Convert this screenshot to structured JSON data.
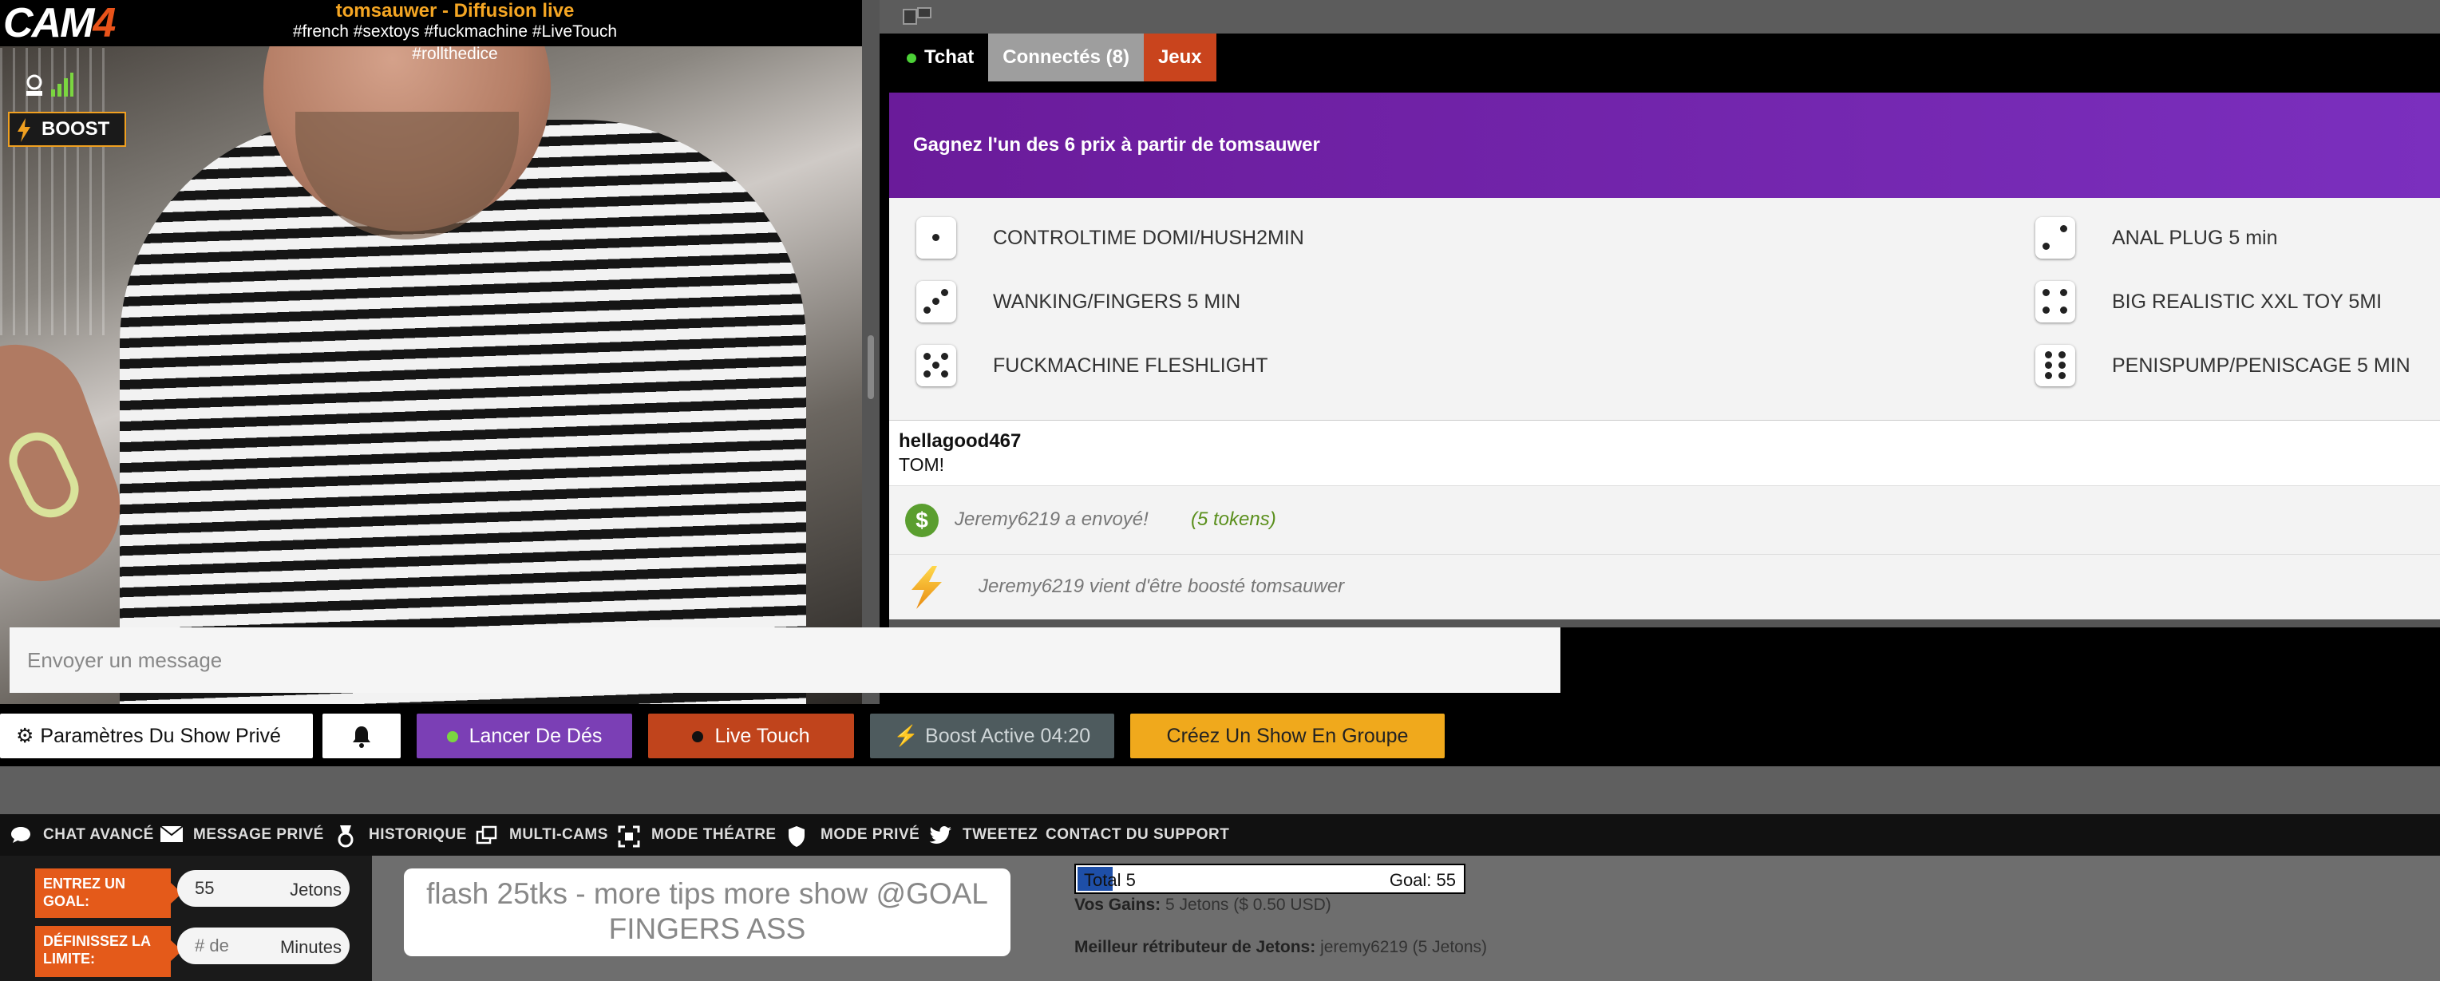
{
  "header": {
    "logo": "CAM4",
    "logo_main": "CAM",
    "logo_number": "4",
    "title": "tomsauwer - Diffusion live",
    "tags": "#french #sextoys #fuckmachine #LiveTouch #rollthedice",
    "boost_label": "BOOST"
  },
  "tabs": {
    "chat": "Tchat",
    "users": "Connectés (8)",
    "games": "Jeux"
  },
  "game": {
    "header": "Gagnez l'un des 6 prix à partir de tomsauwer",
    "prizes": [
      {
        "die": 1,
        "label": "CONTROLTIME DOMI/HUSH2MIN"
      },
      {
        "die": 2,
        "label": "ANAL PLUG 5 min"
      },
      {
        "die": 3,
        "label": "WANKING/FINGERS 5 MIN"
      },
      {
        "die": 4,
        "label": "BIG REALISTIC XXL TOY 5MI"
      },
      {
        "die": 5,
        "label": "FUCKMACHINE FLESHLIGHT"
      },
      {
        "die": 6,
        "label": "PENISPUMP/PENISCAGE 5 MIN"
      }
    ]
  },
  "chat": {
    "messages": [
      {
        "user": "hellagood467",
        "text": "TOM!"
      }
    ],
    "tip_notice": "Jeremy6219 a envoyé!",
    "tip_amount": "(5 tokens)",
    "boost_notice": "Jeremy6219 vient d'être boosté tomsauwer",
    "input_placeholder": "Envoyer un message"
  },
  "toolbar": {
    "private_show": "Paramètres Du Show Privé",
    "dice": "Lancer De Dés",
    "live_touch": "Live Touch",
    "boost_active": "Boost Active 04:20",
    "group_show": "Créez Un Show En Groupe"
  },
  "nav": {
    "advanced_chat": "CHAT AVANCÉ",
    "private_message": "MESSAGE PRIVÉ",
    "history": "HISTORIQUE",
    "multicam": "MULTI-CAMS",
    "theatre_mode": "MODE THÉATRE",
    "private_mode": "MODE PRIVÉ",
    "tweet": "TWEETEZ",
    "support": "CONTACT DU SUPPORT"
  },
  "goal": {
    "goal_label": "ENTREZ UN GOAL:",
    "goal_value": "55",
    "goal_unit": "Jetons",
    "limit_label": "DÉFINISSEZ LA LIMITE:",
    "limit_placeholder": "# de",
    "limit_unit": "Minutes",
    "subject": "flash 25tks - more tips more show @GOAL FINGERS ASS",
    "total_label": "Total 5",
    "goal_total_label": "Goal: 55",
    "progress_fraction": 0.0909,
    "gains_label": "Vos Gains:",
    "gains_value": "5 Jetons ($ 0.50 USD)",
    "top_tipper_label": "Meilleur rétributeur de Jetons:",
    "top_tipper_value": "jeremy6219 (5 Jetons)"
  },
  "colors": {
    "accent_orange": "#e45a1a",
    "purple": "#7b3fb5",
    "tab_games": "#c9441d",
    "group_yellow": "#f0a91c",
    "tip_green": "#5a9e2f"
  }
}
